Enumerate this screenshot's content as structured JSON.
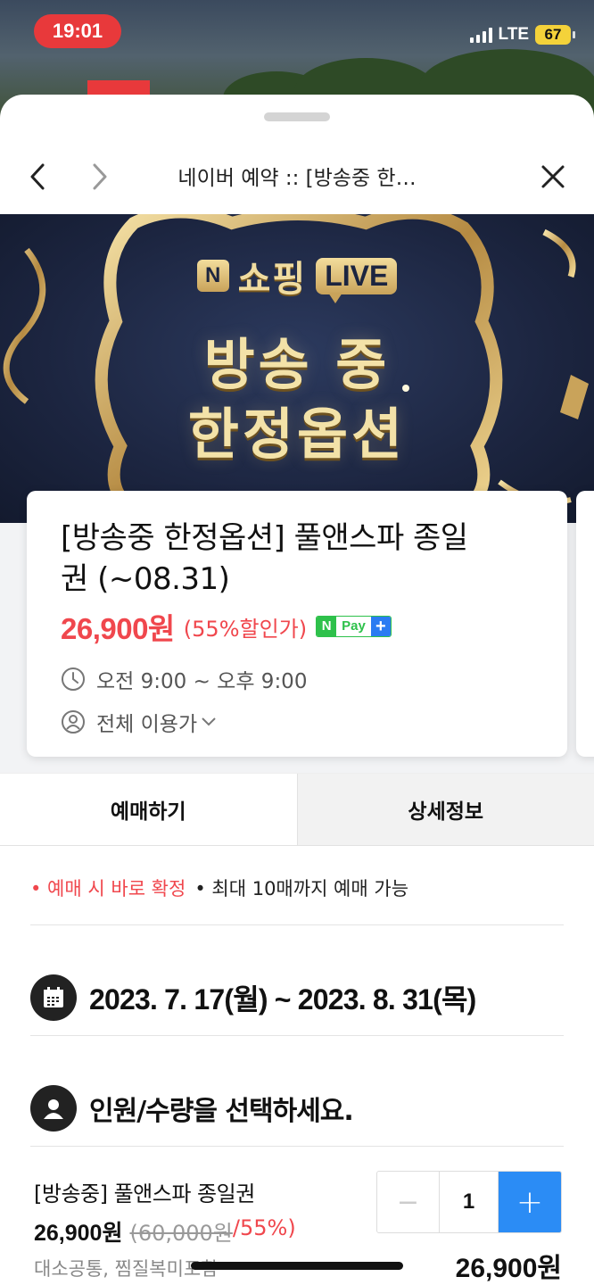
{
  "status_bar": {
    "time": "19:01",
    "network": "LTE",
    "battery": "67"
  },
  "background": {
    "live_tag": "LIVE"
  },
  "nav": {
    "title": "네이버 예약 :: [방송중 한…"
  },
  "banner": {
    "n_logo": "N",
    "brand": "쇼핑",
    "live": "LIVE",
    "line1": "방송 중",
    "line2": "한정옵션"
  },
  "product": {
    "title_line1": "[방송중 한정옵션] 풀앤스파 종일",
    "title_line2": "권 (~08.31)",
    "price": "26,900원",
    "discount": "(55%할인가)",
    "npay": {
      "n": "N",
      "pay": "Pay",
      "plus": "+"
    },
    "hours": "오전 9:00 ~ 오후 9:00",
    "audience": "전체 이용가"
  },
  "tabs": [
    {
      "label": "예매하기"
    },
    {
      "label": "상세정보"
    }
  ],
  "notice": {
    "item1": "• 예매 시 바로 확정",
    "item2": "• 최대 10매까지 예매 가능"
  },
  "date_section": {
    "range": "2023. 7. 17(월) ~ 2023. 8. 31(목)"
  },
  "quantity_section": {
    "title": "인원/수량을 선택하세요."
  },
  "ticket": {
    "name": "[방송중] 풀앤스파 종일권",
    "price": "26,900원",
    "original_price": "(60,000원",
    "discount_pct": "/55%)",
    "description": "대소공통, 찜질복미포함",
    "quantity": "1",
    "minus": "−",
    "plus": "+",
    "total": "26,900원"
  },
  "colors": {
    "accent_red": "#f0474d",
    "accent_blue": "#2b8cf5",
    "npay_green": "#2ec14b",
    "status_red": "#e8393b"
  }
}
